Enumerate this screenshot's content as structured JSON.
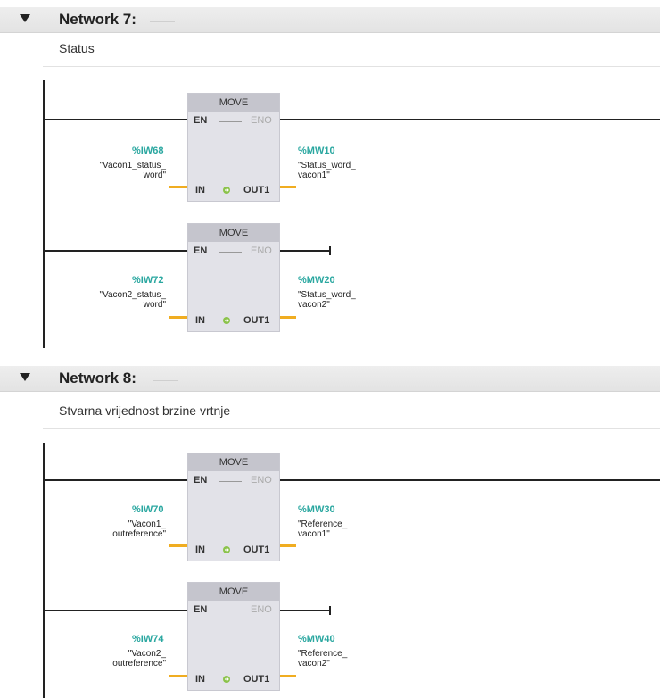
{
  "networks": [
    {
      "title": "Network 7:",
      "comment": "Status",
      "blocks": [
        {
          "name": "MOVE",
          "en": "EN",
          "eno": "ENO",
          "in": "IN",
          "out": "OUT1",
          "in_addr": "%IW68",
          "in_sym_1": "\"Vacon1_status_",
          "in_sym_2": "word\"",
          "out_addr": "%MW10",
          "out_sym_1": "\"Status_word_",
          "out_sym_2": "vacon1\""
        },
        {
          "name": "MOVE",
          "en": "EN",
          "eno": "ENO",
          "in": "IN",
          "out": "OUT1",
          "in_addr": "%IW72",
          "in_sym_1": "\"Vacon2_status_",
          "in_sym_2": "word\"",
          "out_addr": "%MW20",
          "out_sym_1": "\"Status_word_",
          "out_sym_2": "vacon2\""
        }
      ]
    },
    {
      "title": "Network 8:",
      "comment": "Stvarna vrijednost brzine vrtnje",
      "blocks": [
        {
          "name": "MOVE",
          "en": "EN",
          "eno": "ENO",
          "in": "IN",
          "out": "OUT1",
          "in_addr": "%IW70",
          "in_sym_1": "\"Vacon1_",
          "in_sym_2": "outreference\"",
          "out_addr": "%MW30",
          "out_sym_1": "\"Reference_",
          "out_sym_2": "vacon1\""
        },
        {
          "name": "MOVE",
          "en": "EN",
          "eno": "ENO",
          "in": "IN",
          "out": "OUT1",
          "in_addr": "%IW74",
          "in_sym_1": "\"Vacon2_",
          "in_sym_2": "outreference\"",
          "out_addr": "%MW40",
          "out_sym_1": "\"Reference_",
          "out_sym_2": "vacon2\""
        }
      ]
    }
  ],
  "colors": {
    "address": "#2aa7a0",
    "wire": "#222222",
    "operand_line": "#f0ad21",
    "block": "#e2e2e8"
  },
  "icons": {
    "collapse": "triangle-down-icon",
    "move_arrow": "move-arrow-icon"
  }
}
